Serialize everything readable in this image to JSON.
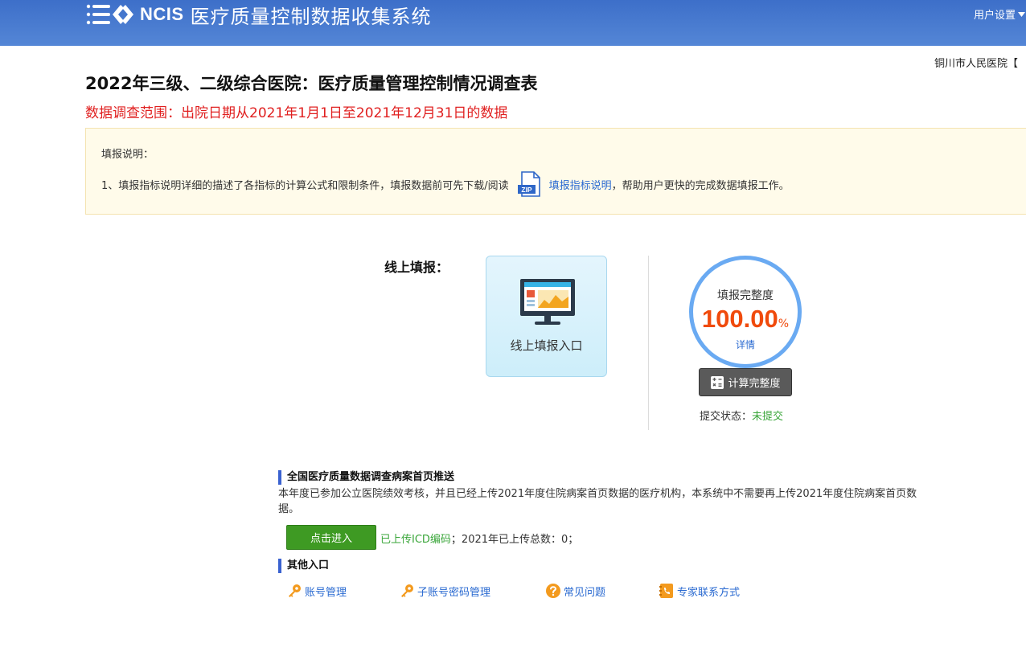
{
  "header": {
    "logo_ncis": "NCIS",
    "system_title": "医疗质量控制数据收集系统",
    "user_settings": "用户设置"
  },
  "hospital": "铜川市人民医院【",
  "page": {
    "title": "2022年三级、二级综合医院：医疗质量管理控制情况调查表",
    "scope": "数据调查范围：出院日期从2021年1月1日至2021年12月31日的数据"
  },
  "notice": {
    "title": "填报说明：",
    "line_prefix": "1、填报指标说明详细的描述了各指标的计算公式和限制条件，填报数据前可先下载/阅读",
    "zip_label": "ZIP",
    "link": "填报指标说明",
    "line_suffix": "，帮助用户更快的完成数据填报工作。"
  },
  "online": {
    "label": "线上填报：",
    "entry_label": "线上填报入口"
  },
  "completeness": {
    "label": "填报完整度",
    "value": "100.00",
    "unit": "%",
    "detail": "详情",
    "calc_button": "计算完整度",
    "status_label": "提交状态：",
    "status_value": "未提交"
  },
  "push_section": {
    "title": "全国医疗质量数据调查病案首页推送",
    "description": "本年度已参加公立医院绩效考核，并且已经上传2021年度住院病案首页数据的医疗机构，本系统中不需要再上传2021年度住院病案首页数据。",
    "enter_button": "点击进入",
    "icd_link": "已上传ICD编码",
    "upload_summary": "；2021年已上传总数：0；"
  },
  "other_section": {
    "title": "其他入口",
    "links": [
      "账号管理",
      "子账号密码管理",
      "常见问题",
      "专家联系方式"
    ]
  },
  "colors": {
    "header": "#4a7bd0",
    "scope_red": "#e02020",
    "percent_orange": "#f04a0c",
    "ring_blue": "#6aaaf2",
    "enter_green": "#3e9a23",
    "link_blue": "#2a6ad1",
    "status_green": "#3aa63a"
  },
  "icons": [
    "ncis-logo-icon",
    "chevron-down-icon",
    "zip-file-icon",
    "monitor-icon",
    "calculator-icon",
    "key-icon",
    "question-icon",
    "phone-book-icon"
  ]
}
